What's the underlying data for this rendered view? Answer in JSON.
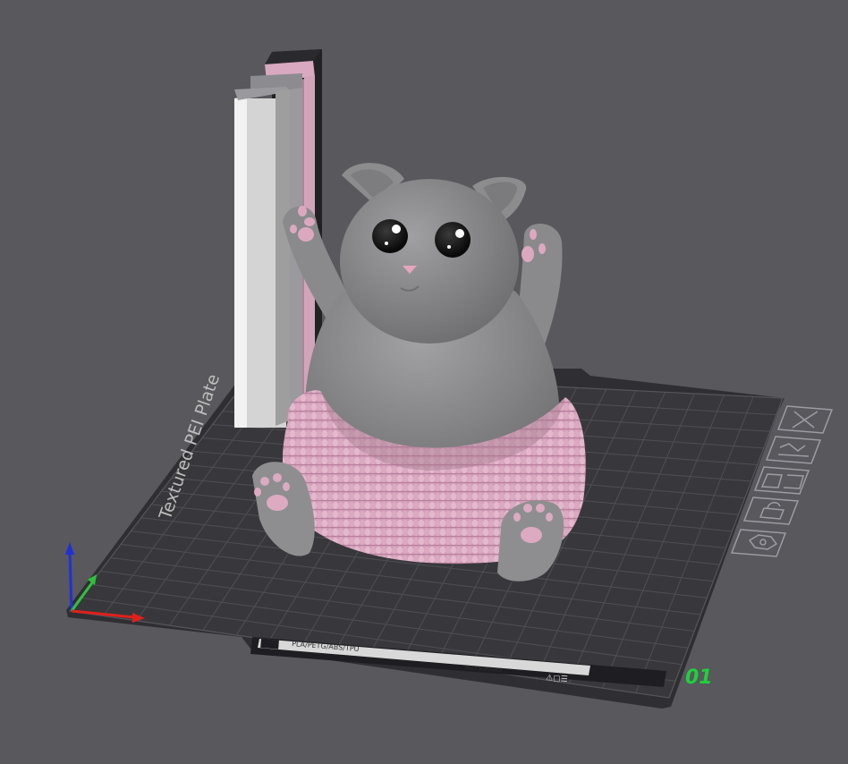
{
  "plate": {
    "name": "Textured PEI Plate",
    "index": "01",
    "label_strip": "PLA/PETG/ABS/TPU",
    "label_hot": "HOT SURFACE"
  },
  "colors": {
    "background": "#58585d",
    "plate": "#333337",
    "grid": "#4d4d53",
    "model_gray": "#8e8e90",
    "model_pink": "#d8a8c0",
    "plate_index": "#1ed13c",
    "axis_x": "#e0201c",
    "axis_y": "#2ec13a",
    "axis_z": "#2030d8"
  },
  "icons": [
    "close-icon",
    "auto-orient-icon",
    "arrange-icon",
    "lock-icon",
    "plate-settings-icon"
  ],
  "models": [
    "wipe-tower",
    "cat-figure"
  ]
}
